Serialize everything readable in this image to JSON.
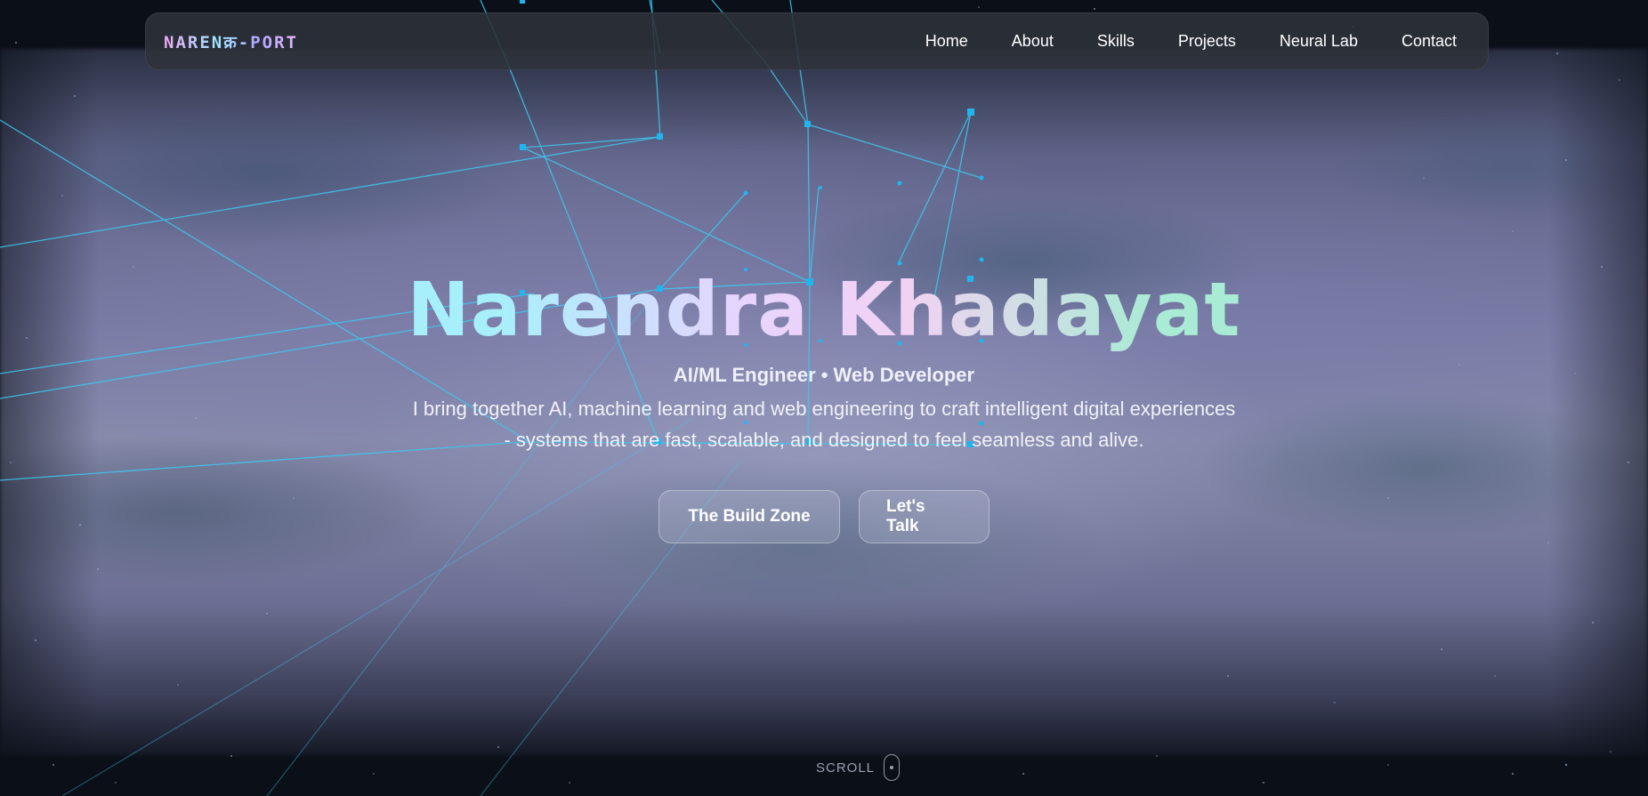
{
  "header": {
    "logo": "NARENक्र-PORT",
    "nav_items": [
      "Home",
      "About",
      "Skills",
      "Projects",
      "Neural Lab",
      "Contact"
    ]
  },
  "hero": {
    "name": "Narendra Khadayat",
    "role": "AI/ML Engineer • Web Developer",
    "description_lines": [
      "I bring together AI, machine learning and web engineering to craft intelligent digital experiences",
      "- systems that are fast, scalable, and designed to feel seamless and alive."
    ],
    "primary_button": "The Build Zone",
    "secondary_button": "Let's Talk"
  },
  "scroll_indicator": {
    "label": "SCROLL"
  },
  "colors": {
    "background": "#0b0f17",
    "network_line": "#3cc8f0",
    "network_node": "#1fb6f0",
    "navbar_bg": "#2d323a",
    "title_gradient": [
      "#a7f0fb",
      "#e7d4ff",
      "#f2d2f3",
      "#a9ebd4"
    ]
  },
  "icons": {
    "scroll": "mouse-icon"
  }
}
